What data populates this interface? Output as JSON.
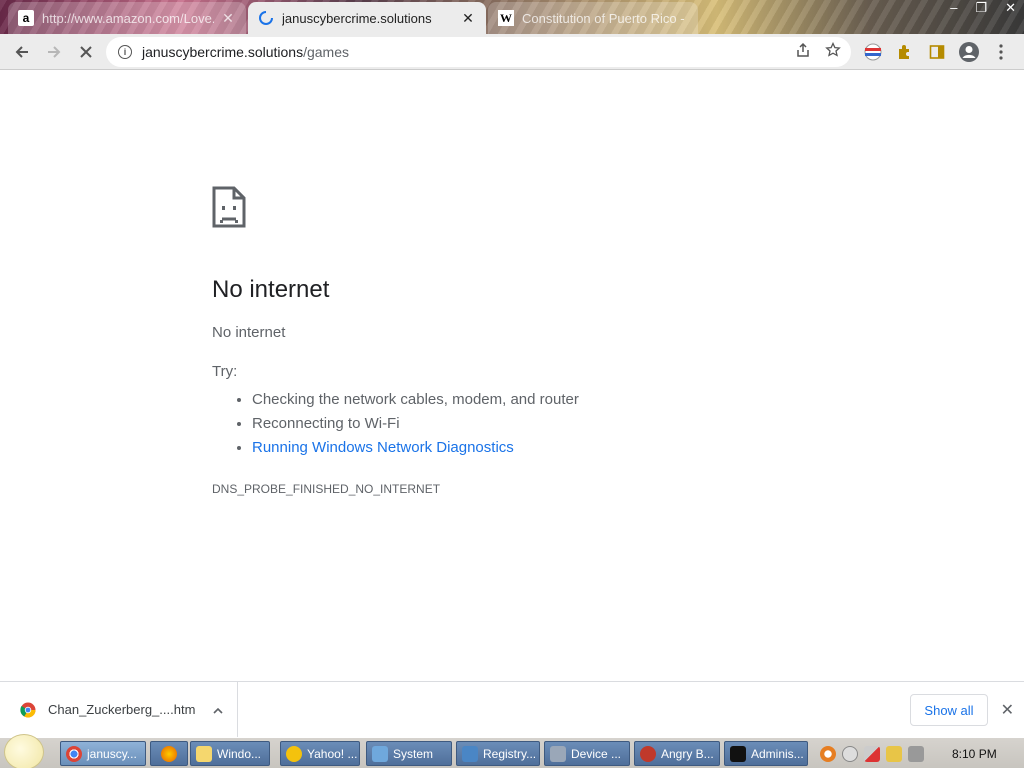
{
  "tabs": [
    {
      "title": "http://www.amazon.com/Love...",
      "favicon": "amazon-icon",
      "active": false
    },
    {
      "title": "januscybercrime.solutions",
      "favicon": "loading-spinner-icon",
      "active": true
    },
    {
      "title": "Constitution of Puerto Rico - W",
      "favicon": "wikipedia-icon",
      "active": false
    }
  ],
  "window_controls": {
    "minimize": "–",
    "restore": "❐",
    "close": "✕"
  },
  "omnibox": {
    "host": "januscybercrime.solutions",
    "path": "/games"
  },
  "error": {
    "title": "No internet",
    "subtitle": "No internet",
    "try_label": "Try:",
    "suggestions": [
      "Checking the network cables, modem, and router",
      "Reconnecting to Wi-Fi",
      "Running Windows Network Diagnostics"
    ],
    "code": "DNS_PROBE_FINISHED_NO_INTERNET"
  },
  "download_shelf": {
    "filename": "Chan_Zuckerberg_....htm",
    "show_all": "Show all"
  },
  "taskbar": {
    "tasks": [
      "januscy...",
      "",
      "Windo...",
      "Yahoo! ...",
      "System",
      "Registry...",
      "Device ...",
      "Angry B...",
      "Adminis..."
    ],
    "clock": "8:10 PM"
  },
  "colors": {
    "link": "#1a73e8",
    "text_secondary": "#5f6368",
    "title": "#202124"
  }
}
